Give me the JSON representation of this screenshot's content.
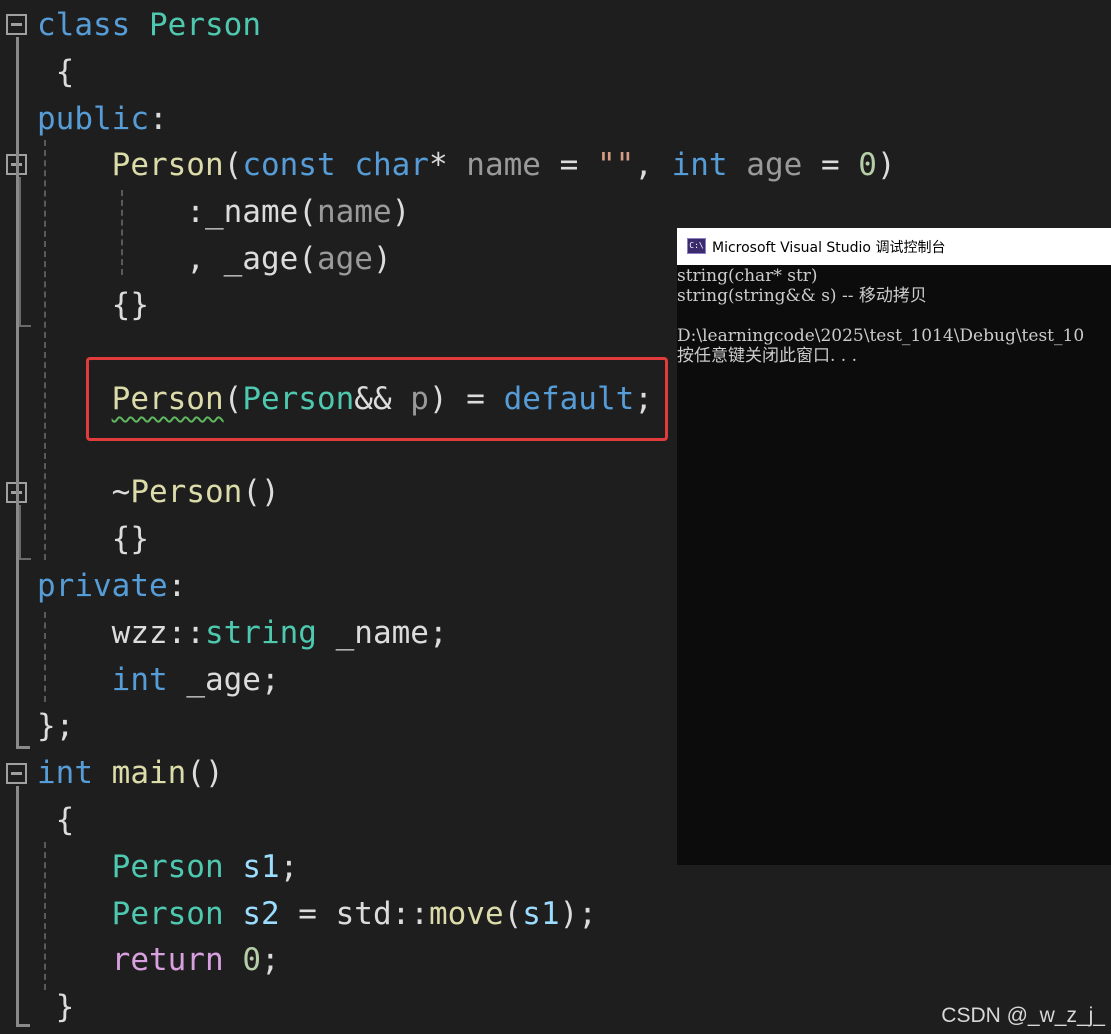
{
  "editor": {
    "lines": [
      {
        "tokens": [
          {
            "t": "class",
            "c": "kw"
          },
          {
            "t": " "
          },
          {
            "t": "Person",
            "c": "type"
          }
        ]
      },
      {
        "tokens": [
          {
            "t": " {"
          }
        ]
      },
      {
        "tokens": [
          {
            "t": "public",
            "c": "kw"
          },
          {
            "t": ":"
          }
        ]
      },
      {
        "tokens": [
          {
            "t": "    "
          },
          {
            "t": "Person",
            "c": "fn"
          },
          {
            "t": "("
          },
          {
            "t": "const",
            "c": "kw"
          },
          {
            "t": " "
          },
          {
            "t": "char",
            "c": "kw"
          },
          {
            "t": "* "
          },
          {
            "t": "name",
            "c": "param"
          },
          {
            "t": " = "
          },
          {
            "t": "\"\"",
            "c": "str"
          },
          {
            "t": ", "
          },
          {
            "t": "int",
            "c": "kw"
          },
          {
            "t": " "
          },
          {
            "t": "age",
            "c": "param"
          },
          {
            "t": " = "
          },
          {
            "t": "0",
            "c": "num"
          },
          {
            "t": ")"
          }
        ]
      },
      {
        "tokens": [
          {
            "t": "        :_name("
          },
          {
            "t": "name",
            "c": "param"
          },
          {
            "t": ")"
          }
        ]
      },
      {
        "tokens": [
          {
            "t": "        , _age("
          },
          {
            "t": "age",
            "c": "param"
          },
          {
            "t": ")"
          }
        ]
      },
      {
        "tokens": [
          {
            "t": "    {}"
          }
        ]
      },
      {
        "tokens": []
      },
      {
        "tokens": [
          {
            "t": "    "
          },
          {
            "t": "Person",
            "c": "fn",
            "squiggle": true
          },
          {
            "t": "("
          },
          {
            "t": "Person",
            "c": "type"
          },
          {
            "t": "&& "
          },
          {
            "t": "p",
            "c": "param"
          },
          {
            "t": ") = "
          },
          {
            "t": "default",
            "c": "kw"
          },
          {
            "t": ";"
          }
        ]
      },
      {
        "tokens": []
      },
      {
        "tokens": [
          {
            "t": "    ~"
          },
          {
            "t": "Person",
            "c": "fn"
          },
          {
            "t": "()"
          }
        ]
      },
      {
        "tokens": [
          {
            "t": "    {}"
          }
        ]
      },
      {
        "tokens": [
          {
            "t": "private",
            "c": "kw"
          },
          {
            "t": ":"
          }
        ]
      },
      {
        "tokens": [
          {
            "t": "    wzz::"
          },
          {
            "t": "string",
            "c": "type"
          },
          {
            "t": " _name;"
          }
        ]
      },
      {
        "tokens": [
          {
            "t": "    "
          },
          {
            "t": "int",
            "c": "kw"
          },
          {
            "t": " _age;"
          }
        ]
      },
      {
        "tokens": [
          {
            "t": "};"
          }
        ]
      },
      {
        "tokens": [
          {
            "t": "int",
            "c": "kw"
          },
          {
            "t": " "
          },
          {
            "t": "main",
            "c": "fn"
          },
          {
            "t": "()"
          }
        ]
      },
      {
        "tokens": [
          {
            "t": " {"
          }
        ]
      },
      {
        "tokens": [
          {
            "t": "    "
          },
          {
            "t": "Person",
            "c": "type"
          },
          {
            "t": " "
          },
          {
            "t": "s1",
            "c": "var"
          },
          {
            "t": ";"
          }
        ]
      },
      {
        "tokens": [
          {
            "t": "    "
          },
          {
            "t": "Person",
            "c": "type"
          },
          {
            "t": " "
          },
          {
            "t": "s2",
            "c": "var"
          },
          {
            "t": " = std::"
          },
          {
            "t": "move",
            "c": "fn"
          },
          {
            "t": "("
          },
          {
            "t": "s1",
            "c": "var"
          },
          {
            "t": ");"
          }
        ]
      },
      {
        "tokens": [
          {
            "t": "    "
          },
          {
            "t": "return",
            "c": "ctl"
          },
          {
            "t": " "
          },
          {
            "t": "0",
            "c": "num"
          },
          {
            "t": ";"
          }
        ]
      },
      {
        "tokens": [
          {
            "t": " }"
          }
        ]
      }
    ]
  },
  "console": {
    "title": "Microsoft Visual Studio 调试控制台",
    "icon": "console-app-icon",
    "icon_label": "C:\\",
    "lines": [
      "string(char* str)",
      "string(string&& s) -- 移动拷贝",
      "",
      "D:\\learningcode\\2025\\test_1014\\Debug\\test_10",
      "按任意键关闭此窗口. . ."
    ]
  },
  "watermark": "CSDN @_w_z_j_",
  "colors": {
    "background": "#1e1e1e",
    "keyword": "#569cd6",
    "type": "#4ec9b0",
    "function": "#dcdcaa",
    "parameter": "#9a9a9a",
    "number": "#b5cea8",
    "control_keyword": "#d8a0df",
    "variable": "#9cdcfe",
    "highlight_box": "#e23b3b",
    "squiggle": "#5fb85f"
  }
}
